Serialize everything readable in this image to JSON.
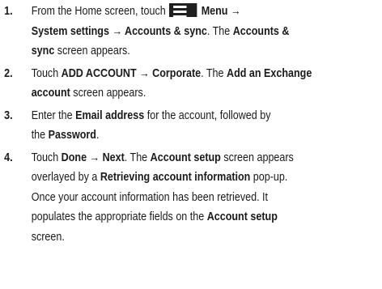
{
  "steps": [
    {
      "number": "1.",
      "lines": [
        [
          "From the Home screen, touch",
          "Menu →"
        ],
        [
          "System settings → Accounts & sync",
          ". The ",
          "Accounts &"
        ],
        [
          "sync",
          " screen appears."
        ]
      ]
    },
    {
      "number": "2.",
      "lines": [
        [
          "Touch ",
          "ADD ACCOUNT → Corporate",
          ". The ",
          "Add an Exchange"
        ],
        [
          "account",
          " screen appears."
        ]
      ]
    },
    {
      "number": "3.",
      "lines": [
        [
          "Enter the ",
          "Email address",
          " for the account, followed by"
        ],
        [
          "the ",
          "Password",
          "."
        ]
      ]
    },
    {
      "number": "4.",
      "lines": [
        [
          "Touch ",
          "Done → Next",
          ". The ",
          "Account setup",
          " screen appears"
        ],
        [
          "overlayed by a ",
          "Retrieving account information",
          " pop-up."
        ],
        [
          "Once your account information has been retrieved.  It"
        ],
        [
          "populates the appropriate fields on the ",
          "Account setup"
        ],
        [
          "screen."
        ]
      ]
    }
  ],
  "icons": {
    "menu": "menu-icon"
  }
}
